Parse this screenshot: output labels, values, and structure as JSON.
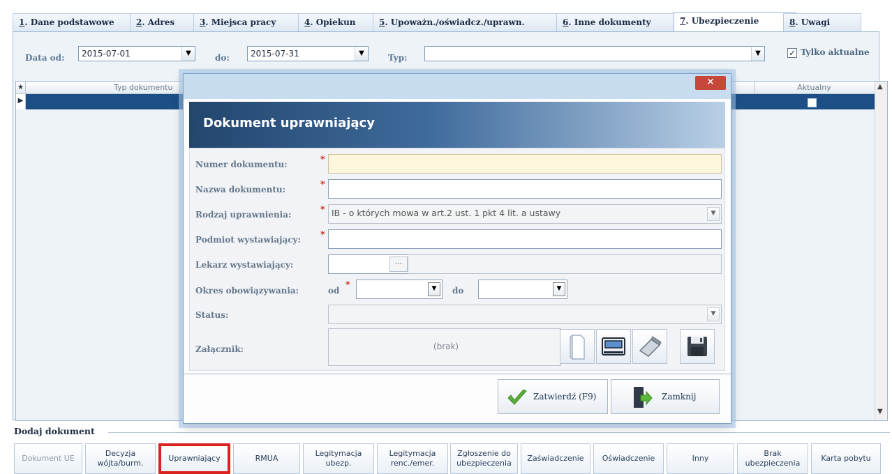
{
  "tabs": [
    {
      "key": "1",
      "label": ". Dane podstawowe"
    },
    {
      "key": "2",
      "label": ". Adres"
    },
    {
      "key": "3",
      "label": ". Miejsca pracy"
    },
    {
      "key": "4",
      "label": ". Opiekun"
    },
    {
      "key": "5",
      "label": ". Upoważn./oświadcz./uprawn."
    },
    {
      "key": "6",
      "label": ". Inne dokumenty"
    },
    {
      "key": "7",
      "label": ". Ubezpieczenie"
    },
    {
      "key": "8",
      "label": ". Uwagi"
    }
  ],
  "filters": {
    "date_from_label": "Data od:",
    "date_from": "2015-07-01",
    "date_to_label": "do:",
    "date_to": "2015-07-31",
    "type_label": "Typ:",
    "type_value": "",
    "only_current_label": "Tylko aktualne",
    "only_current_checked": true
  },
  "grid": {
    "columns": [
      "Typ dokumentu",
      "Aktualny"
    ]
  },
  "add_section": {
    "label": "Dodaj dokument",
    "buttons": [
      "Dokument UE",
      "Decyzja wójta/burm.",
      "Uprawniający",
      "RMUA",
      "Legitymacja ubezp.",
      "Legitymacja renc./emer.",
      "Zgłoszenie do ubezpieczenia",
      "Zaświadczenie",
      "Oświadczenie",
      "Inny",
      "Brak ubezpieczenia",
      "Karta pobytu"
    ]
  },
  "modal": {
    "title": "Dokument uprawniający",
    "close_glyph": "✕",
    "fields": {
      "numer_label": "Numer dokumentu:",
      "numer_value": "",
      "nazwa_label": "Nazwa dokumentu:",
      "nazwa_value": "",
      "rodzaj_label": "Rodzaj uprawnienia:",
      "rodzaj_value": "IB - o których mowa w art.2 ust. 1 pkt 4 lit. a ustawy",
      "podmiot_label": "Podmiot wystawiający:",
      "podmiot_value": "",
      "lekarz_label": "Lekarz wystawiający:",
      "lekarz_button": "...",
      "okres_label": "Okres obowiązywania:",
      "od_label": "od",
      "do_label": "do",
      "status_label": "Status:",
      "zalacznik_label": "Załącznik:",
      "zalacznik_value": "(brak)"
    },
    "confirm_label": "Zatwierdź (F9)",
    "close_label": "Zamknij"
  }
}
